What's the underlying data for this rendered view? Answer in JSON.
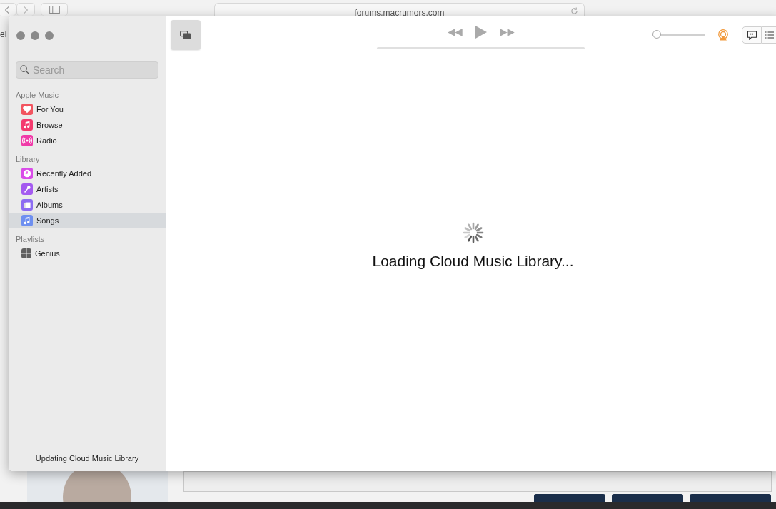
{
  "browser": {
    "address": "forums.macrumors.com",
    "side_text": "el"
  },
  "window": {
    "search": {
      "placeholder": "Search"
    },
    "volume": {
      "level": 0.04
    },
    "sidebar": {
      "sections": [
        {
          "title": "Apple Music",
          "items": [
            {
              "label": "For You",
              "kind": "heart",
              "color": "#f2545f",
              "selected": false
            },
            {
              "label": "Browse",
              "kind": "note",
              "color": "#f43a6e",
              "selected": false
            },
            {
              "label": "Radio",
              "kind": "radio",
              "color": "#f03aa8",
              "selected": false
            }
          ]
        },
        {
          "title": "Library",
          "items": [
            {
              "label": "Recently Added",
              "kind": "clock",
              "color": "#d94be8",
              "selected": false
            },
            {
              "label": "Artists",
              "kind": "mic",
              "color": "#a45af0",
              "selected": false
            },
            {
              "label": "Albums",
              "kind": "albums",
              "color": "#8d6cf2",
              "selected": false
            },
            {
              "label": "Songs",
              "kind": "note",
              "color": "#6e8ff0",
              "selected": true
            }
          ]
        },
        {
          "title": "Playlists",
          "items": [
            {
              "label": "Genius",
              "kind": "grid",
              "color": "#5f5f5f",
              "selected": false
            }
          ]
        }
      ]
    },
    "status": "Updating Cloud Music Library",
    "loading": "Loading Cloud Music Library..."
  }
}
